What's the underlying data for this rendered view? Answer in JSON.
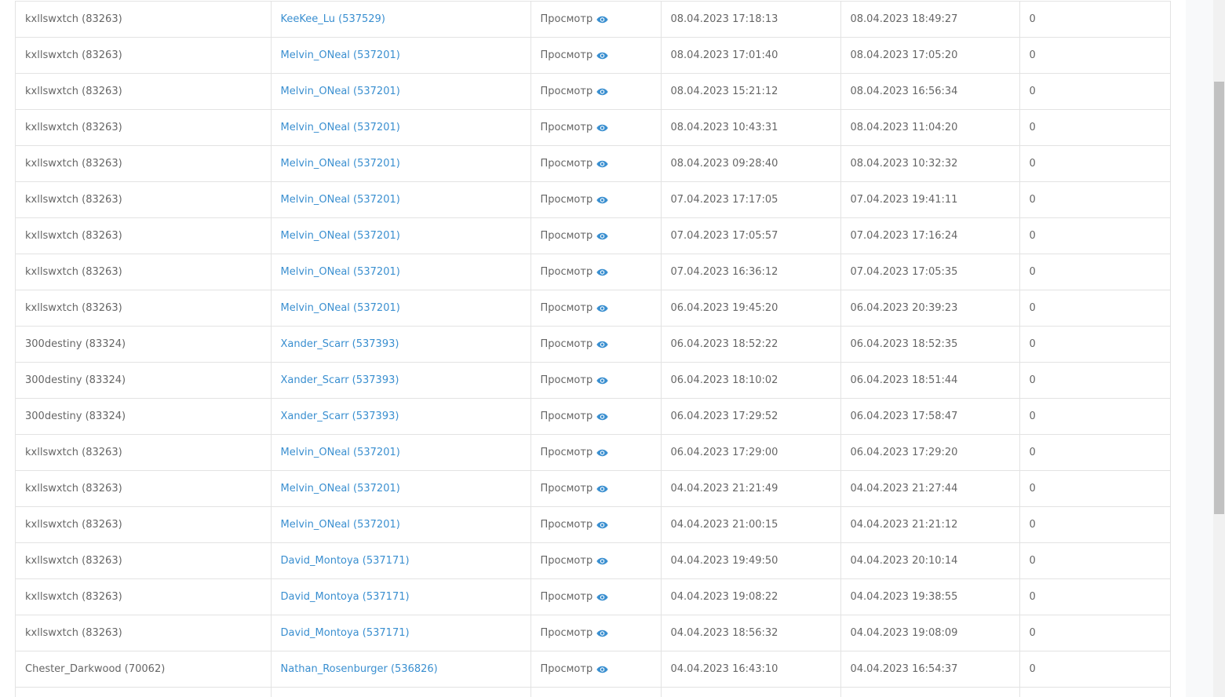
{
  "table": {
    "view_label": "Просмотр",
    "rows": [
      {
        "admin": "kxllswxtch (83263)",
        "player": "KeeKee_Lu (537529)",
        "start": "08.04.2023 17:18:13",
        "end": "08.04.2023 18:49:27",
        "count": "0"
      },
      {
        "admin": "kxllswxtch (83263)",
        "player": "Melvin_ONeal (537201)",
        "start": "08.04.2023 17:01:40",
        "end": "08.04.2023 17:05:20",
        "count": "0"
      },
      {
        "admin": "kxllswxtch (83263)",
        "player": "Melvin_ONeal (537201)",
        "start": "08.04.2023 15:21:12",
        "end": "08.04.2023 16:56:34",
        "count": "0"
      },
      {
        "admin": "kxllswxtch (83263)",
        "player": "Melvin_ONeal (537201)",
        "start": "08.04.2023 10:43:31",
        "end": "08.04.2023 11:04:20",
        "count": "0"
      },
      {
        "admin": "kxllswxtch (83263)",
        "player": "Melvin_ONeal (537201)",
        "start": "08.04.2023 09:28:40",
        "end": "08.04.2023 10:32:32",
        "count": "0"
      },
      {
        "admin": "kxllswxtch (83263)",
        "player": "Melvin_ONeal (537201)",
        "start": "07.04.2023 17:17:05",
        "end": "07.04.2023 19:41:11",
        "count": "0"
      },
      {
        "admin": "kxllswxtch (83263)",
        "player": "Melvin_ONeal (537201)",
        "start": "07.04.2023 17:05:57",
        "end": "07.04.2023 17:16:24",
        "count": "0"
      },
      {
        "admin": "kxllswxtch (83263)",
        "player": "Melvin_ONeal (537201)",
        "start": "07.04.2023 16:36:12",
        "end": "07.04.2023 17:05:35",
        "count": "0"
      },
      {
        "admin": "kxllswxtch (83263)",
        "player": "Melvin_ONeal (537201)",
        "start": "06.04.2023 19:45:20",
        "end": "06.04.2023 20:39:23",
        "count": "0"
      },
      {
        "admin": "300destiny (83324)",
        "player": "Xander_Scarr (537393)",
        "start": "06.04.2023 18:52:22",
        "end": "06.04.2023 18:52:35",
        "count": "0"
      },
      {
        "admin": "300destiny (83324)",
        "player": "Xander_Scarr (537393)",
        "start": "06.04.2023 18:10:02",
        "end": "06.04.2023 18:51:44",
        "count": "0"
      },
      {
        "admin": "300destiny (83324)",
        "player": "Xander_Scarr (537393)",
        "start": "06.04.2023 17:29:52",
        "end": "06.04.2023 17:58:47",
        "count": "0"
      },
      {
        "admin": "kxllswxtch (83263)",
        "player": "Melvin_ONeal (537201)",
        "start": "06.04.2023 17:29:00",
        "end": "06.04.2023 17:29:20",
        "count": "0"
      },
      {
        "admin": "kxllswxtch (83263)",
        "player": "Melvin_ONeal (537201)",
        "start": "04.04.2023 21:21:49",
        "end": "04.04.2023 21:27:44",
        "count": "0"
      },
      {
        "admin": "kxllswxtch (83263)",
        "player": "Melvin_ONeal (537201)",
        "start": "04.04.2023 21:00:15",
        "end": "04.04.2023 21:21:12",
        "count": "0"
      },
      {
        "admin": "kxllswxtch (83263)",
        "player": "David_Montoya (537171)",
        "start": "04.04.2023 19:49:50",
        "end": "04.04.2023 20:10:14",
        "count": "0"
      },
      {
        "admin": "kxllswxtch (83263)",
        "player": "David_Montoya (537171)",
        "start": "04.04.2023 19:08:22",
        "end": "04.04.2023 19:38:55",
        "count": "0"
      },
      {
        "admin": "kxllswxtch (83263)",
        "player": "David_Montoya (537171)",
        "start": "04.04.2023 18:56:32",
        "end": "04.04.2023 19:08:09",
        "count": "0"
      },
      {
        "admin": "Chester_Darkwood (70062)",
        "player": "Nathan_Rosenburger (536826)",
        "start": "04.04.2023 16:43:10",
        "end": "04.04.2023 16:54:37",
        "count": "0"
      },
      {
        "admin": "",
        "player": "",
        "start": "",
        "end": "",
        "count": ""
      }
    ]
  },
  "colors": {
    "link": "#3a8fd0",
    "text": "#666666",
    "border": "#e3e3e3",
    "eye_icon": "#3a8fd0"
  },
  "icons": {
    "view": "eye-icon"
  }
}
